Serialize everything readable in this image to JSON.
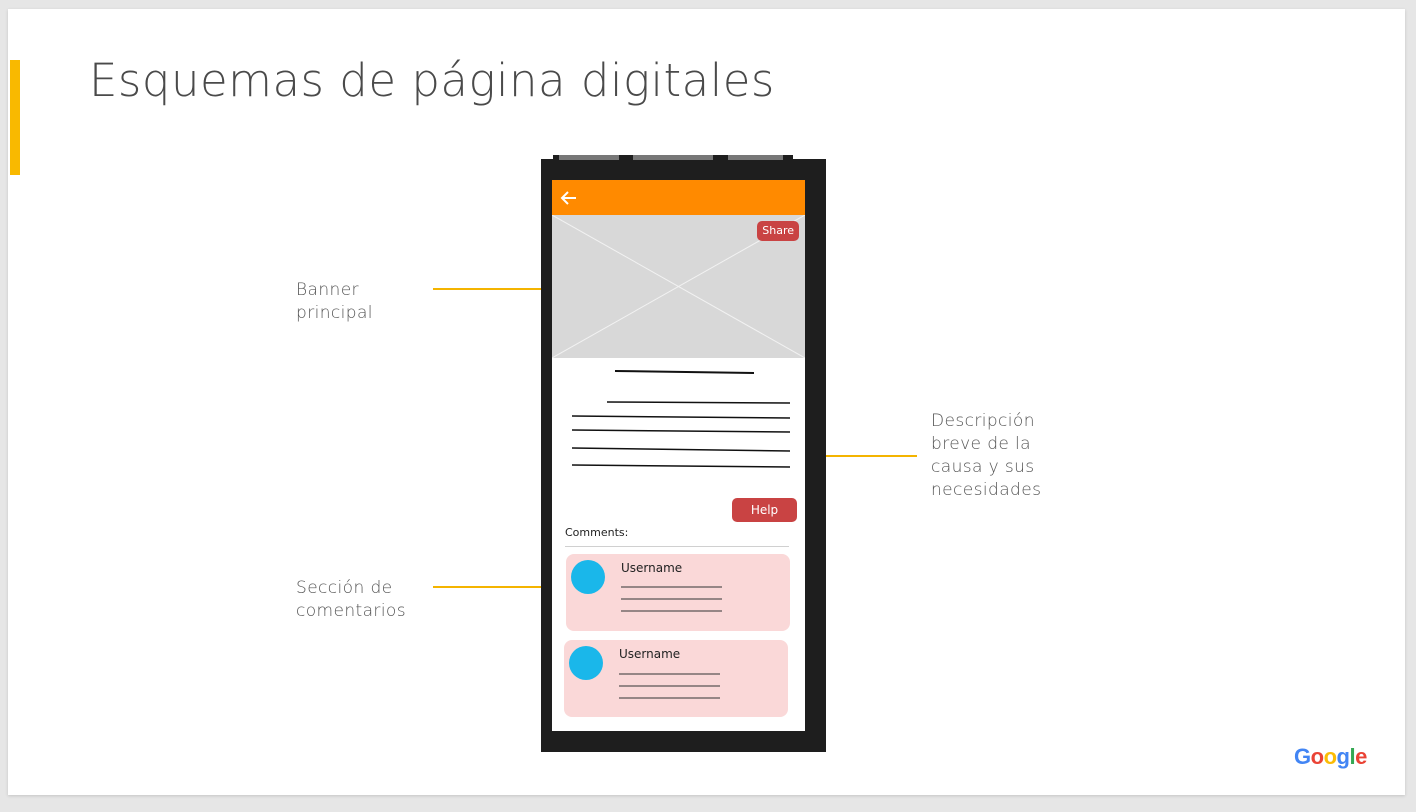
{
  "slide": {
    "title": "Esquemas de página digitales"
  },
  "annotations": {
    "banner": [
      "Banner",
      "principal"
    ],
    "description": [
      "Descripción",
      "breve de la",
      "causa y sus",
      "necesidades"
    ],
    "comments": [
      "Sección de",
      "comentarios"
    ]
  },
  "phone": {
    "share_label": "Share",
    "help_label": "Help",
    "comments_label": "Comments:",
    "comments": [
      {
        "username": "Username"
      },
      {
        "username": "Username"
      }
    ]
  },
  "branding": {
    "logo_letters": [
      "G",
      "o",
      "o",
      "g",
      "l",
      "e"
    ],
    "logo_colors": [
      "#4285F4",
      "#EA4335",
      "#FBBC05",
      "#4285F4",
      "#34A853",
      "#EA4335"
    ]
  },
  "colors": {
    "accent": "#f9b900",
    "appbar": "#ff8a00",
    "button": "#c94343",
    "avatar": "#1ab7ea",
    "comment_card": "#fad8d8"
  }
}
